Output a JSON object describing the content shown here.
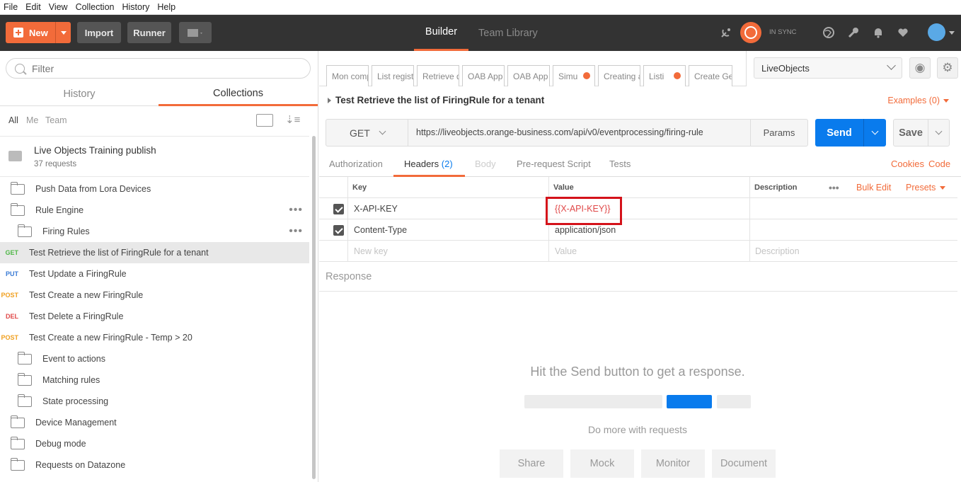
{
  "menu": [
    "File",
    "Edit",
    "View",
    "Collection",
    "History",
    "Help"
  ],
  "header": {
    "new_label": "New",
    "import_label": "Import",
    "runner_label": "Runner",
    "tab_builder": "Builder",
    "tab_team": "Team Library",
    "sync_status": "IN SYNC"
  },
  "sidebar": {
    "filter_placeholder": "Filter",
    "tab_history": "History",
    "tab_collections": "Collections",
    "filter_all": "All",
    "filter_me": "Me",
    "filter_team": "Team",
    "collection_title": "Live Objects Training publish",
    "collection_count": "37 requests",
    "items": [
      {
        "type": "folder",
        "label": "Push Data from Lora Devices"
      },
      {
        "type": "folder-open",
        "label": "Rule Engine"
      },
      {
        "type": "folder-open",
        "label": "Firing Rules"
      },
      {
        "type": "request",
        "method": "GET",
        "label": "Test Retrieve the list of FiringRule for a tenant"
      },
      {
        "type": "request",
        "method": "PUT",
        "label": "Test Update a FiringRule"
      },
      {
        "type": "request",
        "method": "POST",
        "label": "Test Create a new FiringRule"
      },
      {
        "type": "request",
        "method": "DEL",
        "label": "Test Delete a FiringRule"
      },
      {
        "type": "request",
        "method": "POST",
        "label": "Test Create a new FiringRule - Temp > 20"
      },
      {
        "type": "folder",
        "label": "Event to actions"
      },
      {
        "type": "folder",
        "label": "Matching rules"
      },
      {
        "type": "folder",
        "label": "State processing"
      },
      {
        "type": "folder",
        "label": "Device Management"
      },
      {
        "type": "folder",
        "label": "Debug mode"
      },
      {
        "type": "folder",
        "label": "Requests on Datazone"
      }
    ]
  },
  "request_tabs": [
    "Mon comp",
    "List registe",
    "Retrieve d",
    "OAB App -",
    "OAB App -",
    "Simu",
    "Creating a",
    "Listi",
    "Create Ge"
  ],
  "environment": {
    "selected": "LiveObjects"
  },
  "request": {
    "name": "Test Retrieve the list of FiringRule for a tenant",
    "examples": "Examples (0)",
    "method": "GET",
    "url": "https://liveobjects.orange-business.com/api/v0/eventprocessing/firing-rule",
    "params_label": "Params",
    "send_label": "Send",
    "save_label": "Save"
  },
  "subtabs": {
    "authorization": "Authorization",
    "headers": "Headers",
    "headers_count": "(2)",
    "body": "Body",
    "prerequest": "Pre-request Script",
    "tests": "Tests",
    "cookies": "Cookies",
    "code": "Code"
  },
  "headers_table": {
    "col_key": "Key",
    "col_value": "Value",
    "col_description": "Description",
    "bulk_edit": "Bulk Edit",
    "presets": "Presets",
    "rows": [
      {
        "key": "X-API-KEY",
        "value": "{{X-API-KEY}}",
        "checked": true
      },
      {
        "key": "Content-Type",
        "value": "application/json",
        "checked": true
      }
    ],
    "new_key_placeholder": "New key",
    "value_placeholder": "Value",
    "description_placeholder": "Description"
  },
  "response": {
    "label": "Response",
    "hint": "Hit the Send button to get a response.",
    "more": "Do more with requests",
    "actions": [
      "Share",
      "Mock",
      "Monitor",
      "Document"
    ]
  },
  "colors": {
    "accent": "#f26b3a",
    "primary": "#097bed",
    "highlight_box": "#d4121a"
  }
}
